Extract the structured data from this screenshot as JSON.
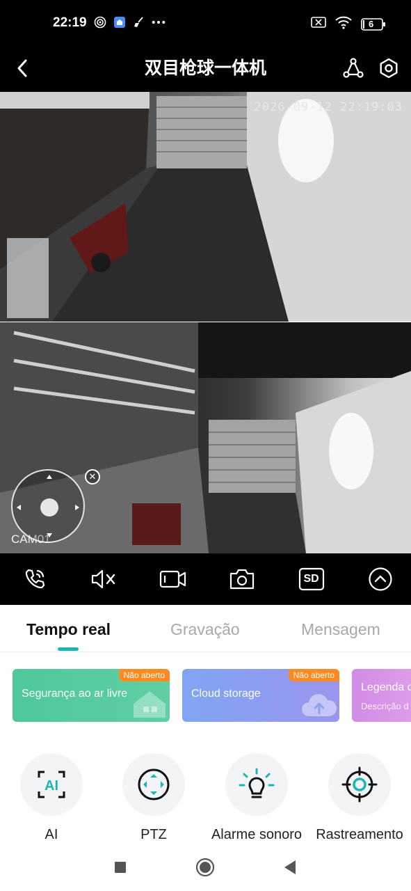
{
  "status_bar": {
    "time": "22:19",
    "battery": "6",
    "icons": [
      "target-icon",
      "home-app-icon",
      "broom-icon",
      "more-dots-icon",
      "sim-off-icon",
      "wifi-icon",
      "battery-icon"
    ]
  },
  "app_bar": {
    "title": "双目枪球一体机"
  },
  "feeds": {
    "cam1": {
      "timestamp": "2026-09-12 22:19:03"
    },
    "cam2": {
      "label": "CAM01"
    }
  },
  "controls": [
    "call-icon",
    "mute-icon",
    "record-video-icon",
    "snapshot-icon",
    "sd-quality-icon",
    "collapse-icon"
  ],
  "controls_sd_label": "SD",
  "tabs": [
    {
      "label": "Tempo real",
      "active": true
    },
    {
      "label": "Gravação",
      "active": false
    },
    {
      "label": "Mensagem",
      "active": false
    }
  ],
  "cards": [
    {
      "title": "Segurança ao ar livre",
      "badge": "Não aberto",
      "color": "#4ec89b"
    },
    {
      "title": "Cloud storage",
      "badge": "Não aberto",
      "color": "#80a5f3"
    },
    {
      "title": "Legenda d",
      "subtitle": "Descrição d",
      "color": "#d18be6"
    }
  ],
  "features": [
    {
      "label": "AI",
      "icon": "ai-icon"
    },
    {
      "label": "PTZ",
      "icon": "ptz-icon"
    },
    {
      "label": "Alarme sonoro",
      "icon": "light-bulb-icon"
    },
    {
      "label": "Rastreamento",
      "icon": "tracking-target-icon"
    }
  ],
  "accent_color": "#1bb5b7"
}
